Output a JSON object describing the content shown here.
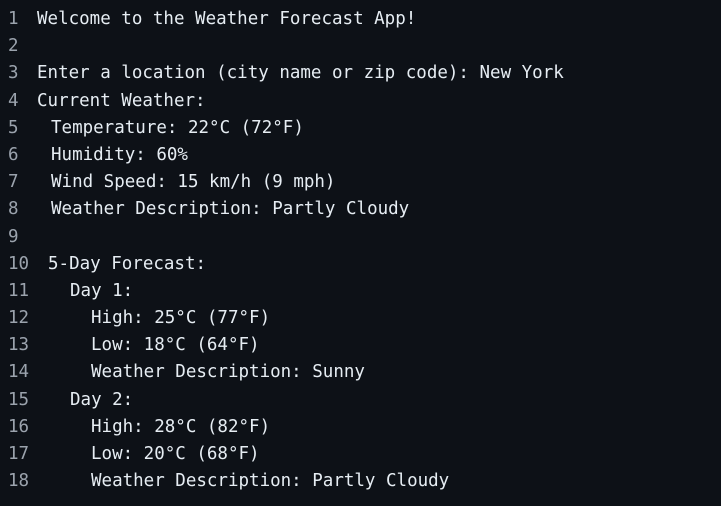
{
  "editor": {
    "lines": [
      {
        "num": "1",
        "text": "Welcome to the Weather Forecast App!"
      },
      {
        "num": "2",
        "text": ""
      },
      {
        "num": "3",
        "text": "Enter a location (city name or zip code): New York"
      },
      {
        "num": "4",
        "text": "Current Weather:"
      },
      {
        "num": "5",
        "text": "Temperature: 22°C (72°F)"
      },
      {
        "num": "6",
        "text": "Humidity: 60%"
      },
      {
        "num": "7",
        "text": "Wind Speed: 15 km/h (9 mph)"
      },
      {
        "num": "8",
        "text": "Weather Description: Partly Cloudy"
      },
      {
        "num": "9",
        "text": ""
      },
      {
        "num": "10",
        "text": "5-Day Forecast:"
      },
      {
        "num": "11",
        "text": "Day 1:"
      },
      {
        "num": "12",
        "text": "High: 25°C (77°F)"
      },
      {
        "num": "13",
        "text": "Low: 18°C (64°F)"
      },
      {
        "num": "14",
        "text": "Weather Description: Sunny"
      },
      {
        "num": "15",
        "text": "Day 2:"
      },
      {
        "num": "16",
        "text": "High: 28°C (82°F)"
      },
      {
        "num": "17",
        "text": "Low: 20°C (68°F)"
      },
      {
        "num": "18",
        "text": "Weather Description: Partly Cloudy"
      }
    ]
  },
  "colors": {
    "background": "#0d1117",
    "text": "#e6edf3",
    "line_number": "#9ba3ad"
  }
}
